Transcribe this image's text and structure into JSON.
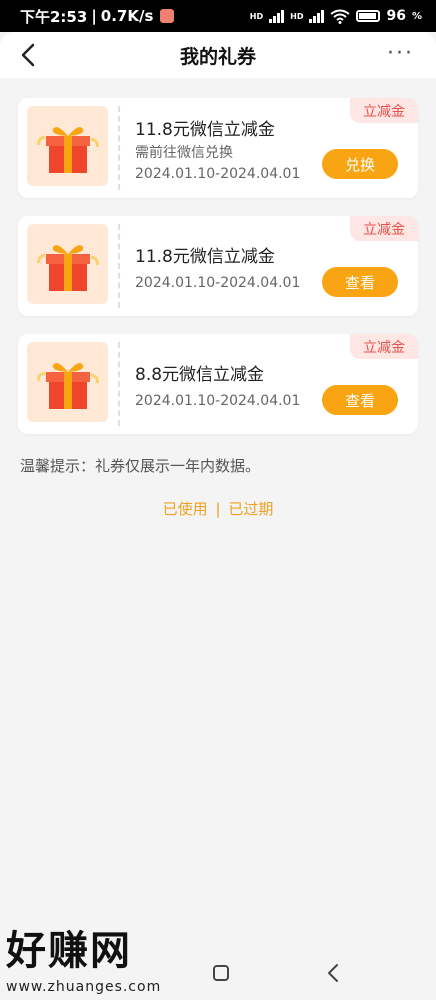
{
  "status_bar": {
    "time": "下午2:53",
    "speed": "0.7K/s",
    "signal1": "HD",
    "signal2": "HD",
    "battery": "96"
  },
  "header": {
    "title": "我的礼券",
    "more": "···"
  },
  "coupons": [
    {
      "badge": "立减金",
      "name": "11.8元微信立减金",
      "sub": "需前往微信兑换",
      "date": "2024.01.10-2024.04.01",
      "action": "兑换"
    },
    {
      "badge": "立减金",
      "name": "11.8元微信立减金",
      "sub": "",
      "date": "2024.01.10-2024.04.01",
      "action": "查看"
    },
    {
      "badge": "立减金",
      "name": "8.8元微信立减金",
      "sub": "",
      "date": "2024.01.10-2024.04.01",
      "action": "查看"
    }
  ],
  "tip": "温馨提示：礼券仅展示一年内数据。",
  "links": {
    "used": "已使用",
    "separator": "|",
    "expired": "已过期"
  },
  "watermark": {
    "big": "好赚网",
    "small": "www.zhuanges.com"
  },
  "colors": {
    "accent": "#f9a412",
    "badge_text": "#e8514a",
    "badge_bg": "#fde6e3",
    "link": "#f0a020"
  },
  "icons": {
    "back": "chevron-left-icon",
    "more": "more-dots-icon",
    "gift": "gift-box-icon",
    "nav_home": "square-icon",
    "nav_back": "triangle-back-icon"
  }
}
